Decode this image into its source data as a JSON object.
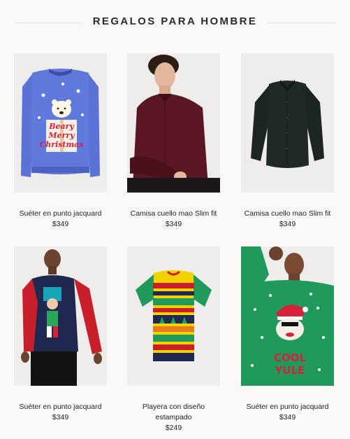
{
  "header": {
    "title": "REGALOS PARA HOMBRE"
  },
  "products": [
    {
      "name": "Suéter en punto jacquard",
      "price": "$349",
      "print": [
        "Beary",
        "Merry",
        "Christmas"
      ]
    },
    {
      "name": "Camisa cuello mao Slim fit",
      "price": "$349"
    },
    {
      "name": "Camisa cuello mao Slim fit",
      "price": "$349"
    },
    {
      "name": "Suéter en punto jacquard",
      "price": "$349"
    },
    {
      "name": "Playera con diseño estampado",
      "price": "$249"
    },
    {
      "name": "Suéter en punto jacquard",
      "price": "$349",
      "print": [
        "COOL",
        "YULE"
      ]
    }
  ],
  "colors": {
    "background": "#faf9f8",
    "image_bg": "#efedeb",
    "sweater_blue": "#5b72d6",
    "shirt_burgundy": "#5a1622",
    "shirt_dark": "#1f2a26",
    "sweater_navy": "#1f2850",
    "sweater_red": "#c8202a",
    "sweater_green": "#1f9a5a"
  }
}
